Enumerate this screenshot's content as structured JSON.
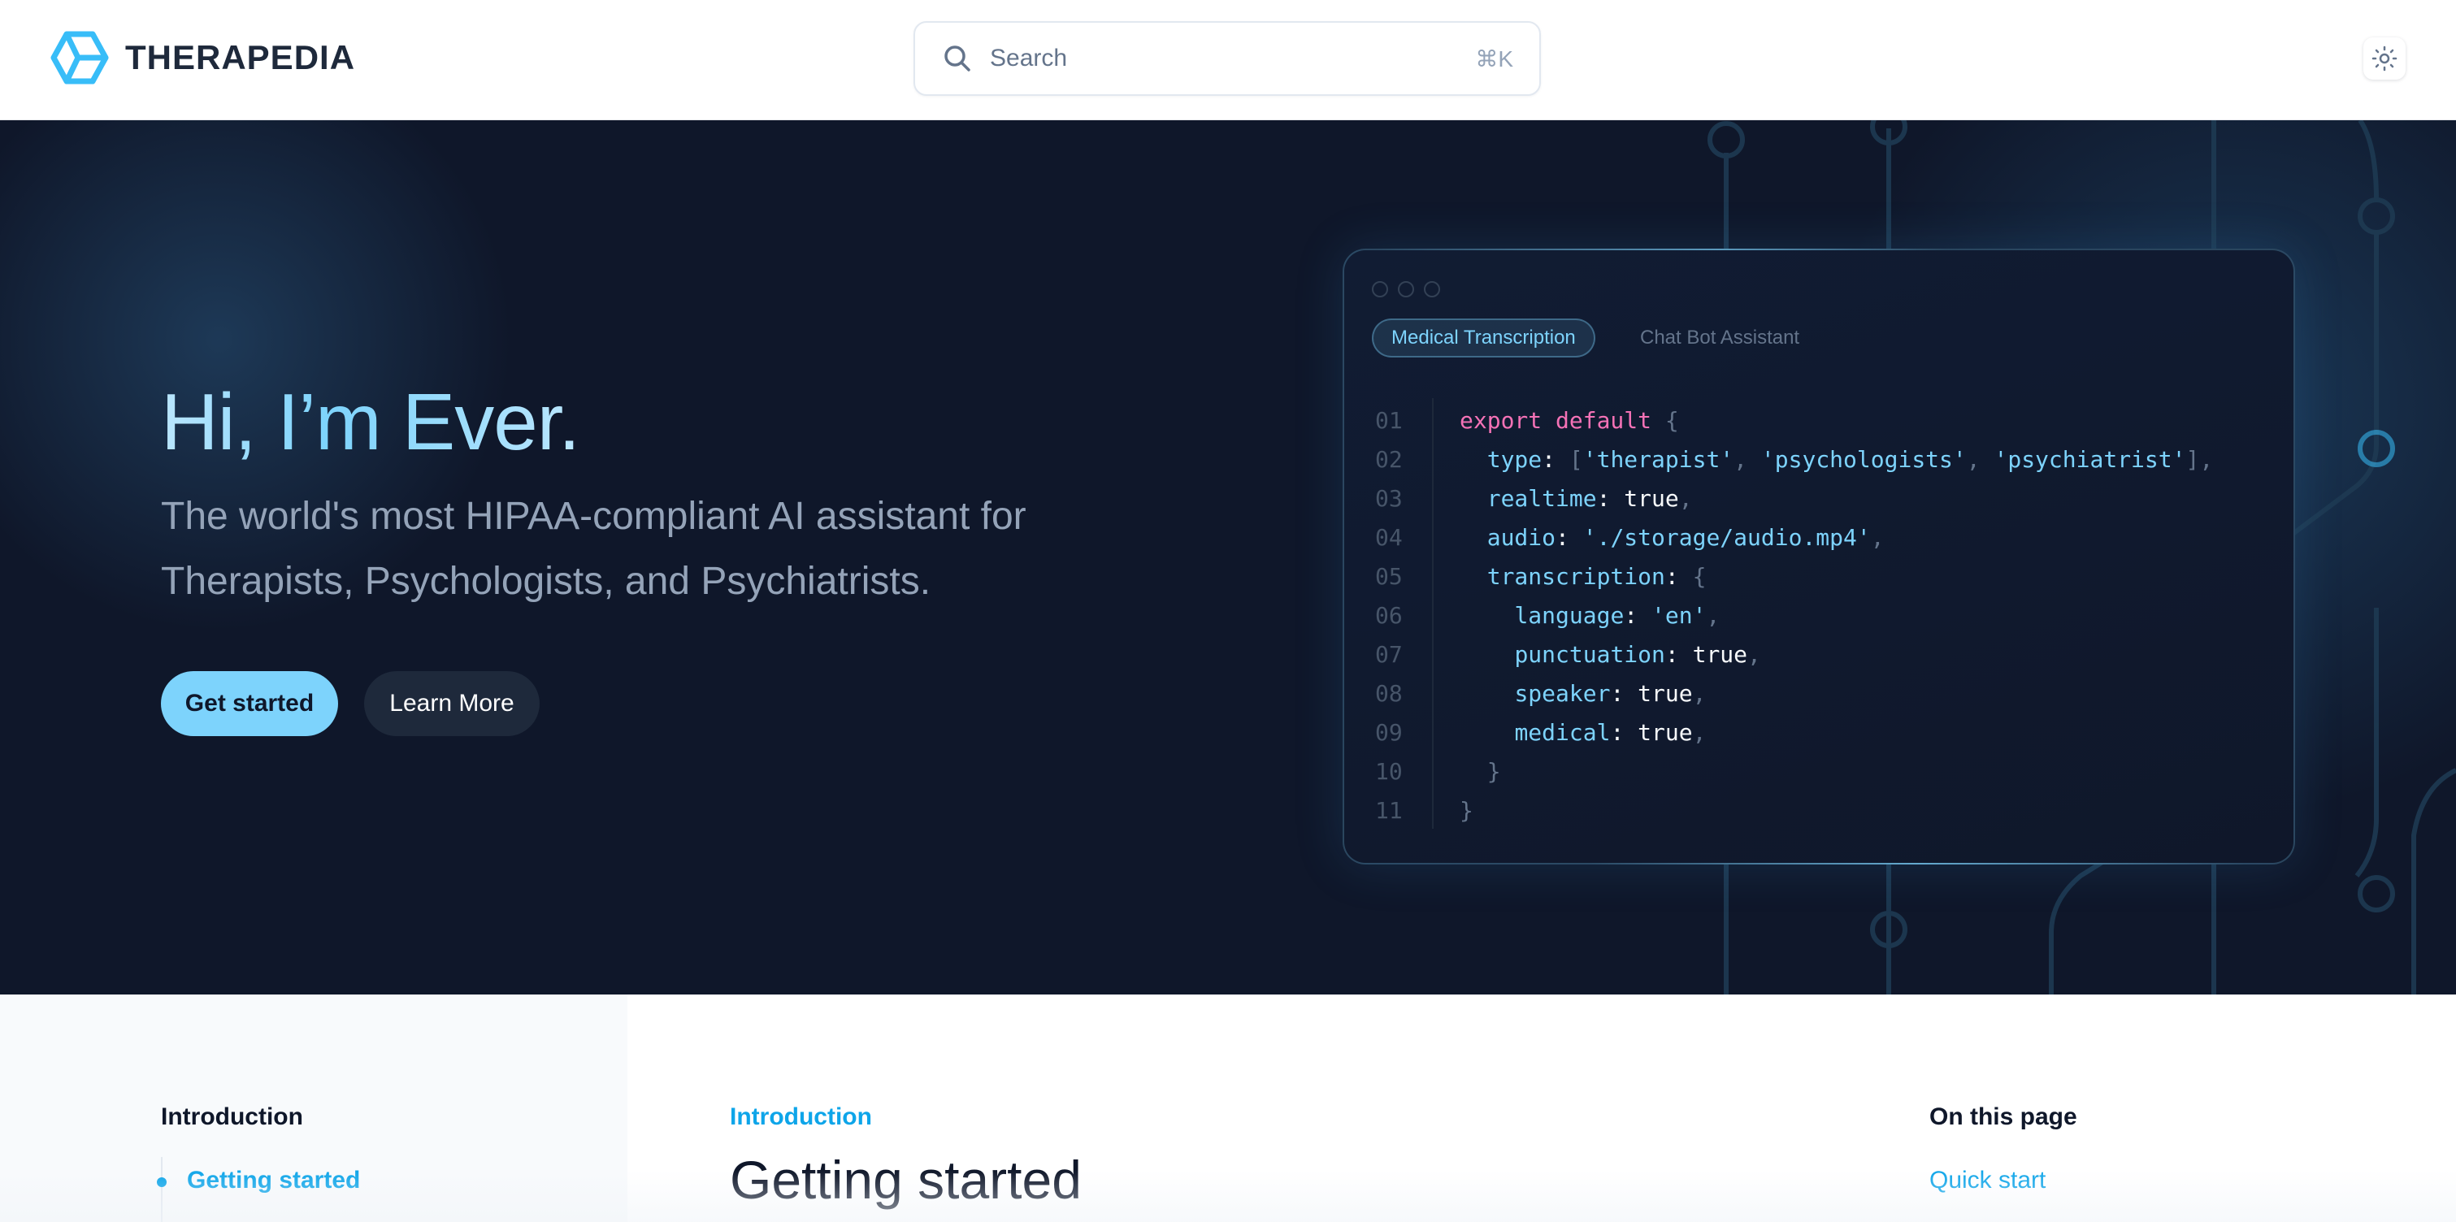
{
  "header": {
    "brand": "THERAPEDIA",
    "search_placeholder": "Search",
    "search_shortcut": "⌘K",
    "logo_icon": "hexagon-cube-logo",
    "theme_icon": "sun-icon"
  },
  "hero": {
    "title_hi": "Hi, ",
    "title_name": "I’m Ever.",
    "subtitle": "The world's most HIPAA-compliant AI assistant for Therapists, Psychologists, and Psychiatrists.",
    "primary_button": "Get started",
    "secondary_button": "Learn More"
  },
  "code_window": {
    "tabs": [
      "Medical Transcription",
      "Chat Bot Assistant"
    ],
    "line_numbers": [
      "01",
      "02",
      "03",
      "04",
      "05",
      "06",
      "07",
      "08",
      "09",
      "10",
      "11"
    ]
  },
  "docs": {
    "nav_heading": "Introduction",
    "nav_items": [
      "Getting started"
    ],
    "eyebrow": "Introduction",
    "page_title": "Getting started",
    "toc_heading": "On this page",
    "toc_links": [
      "Quick start"
    ]
  },
  "colors": {
    "accent": "#7dd3fc",
    "link": "#0ea5e9",
    "hero_bg": "#0f172a",
    "keyword": "#f472b6"
  }
}
